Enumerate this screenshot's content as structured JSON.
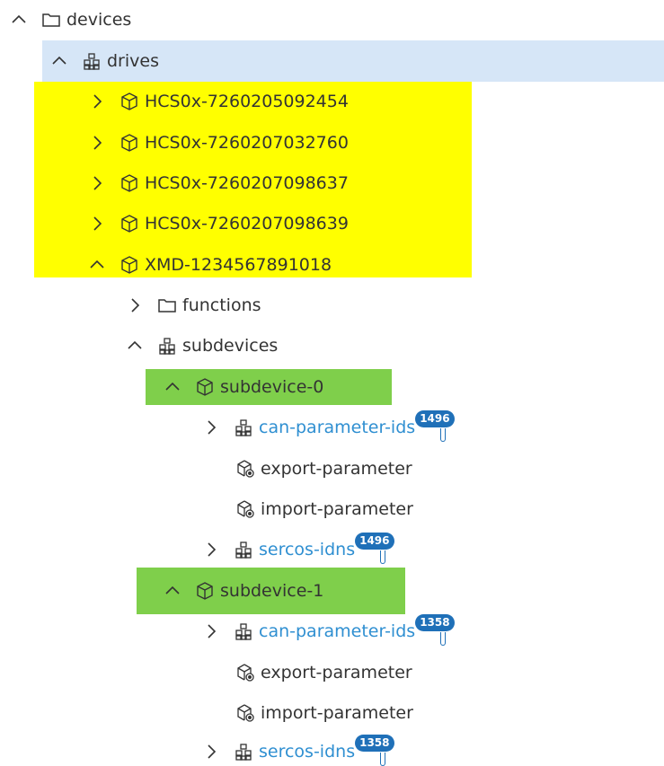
{
  "tree": {
    "devices": {
      "label": "devices"
    },
    "drives": {
      "label": "drives"
    },
    "hcs": [
      {
        "label": "HCS0x-7260205092454"
      },
      {
        "label": "HCS0x-7260207032760"
      },
      {
        "label": "HCS0x-7260207098637"
      },
      {
        "label": "HCS0x-7260207098639"
      }
    ],
    "xmd": {
      "label": "XMD-1234567891018"
    },
    "functions": {
      "label": "functions"
    },
    "subdevices": {
      "label": "subdevices"
    },
    "subdevice0": {
      "label": "subdevice-0",
      "can": {
        "label": "can-parameter-ids",
        "count": "1496"
      },
      "export": {
        "label": "export-parameter"
      },
      "import": {
        "label": "import-parameter"
      },
      "sercos": {
        "label": "sercos-idns",
        "count": "1496"
      }
    },
    "subdevice1": {
      "label": "subdevice-1",
      "can": {
        "label": "can-parameter-ids",
        "count": "1358"
      },
      "export": {
        "label": "export-parameter"
      },
      "import": {
        "label": "import-parameter"
      },
      "sercos": {
        "label": "sercos-idns",
        "count": "1358"
      }
    }
  },
  "colors": {
    "selected_row": "#d6e6f7",
    "highlight_yellow": "#ffff00",
    "highlight_green": "#7fcf4b",
    "link": "#2f8fd1",
    "badge": "#1f70b8"
  },
  "icons": {
    "expanded": "chevron-up-icon",
    "collapsed": "chevron-right-icon",
    "folder": "folder-icon",
    "group": "group-icon",
    "device": "cube-icon",
    "method": "cube-gear-icon"
  }
}
